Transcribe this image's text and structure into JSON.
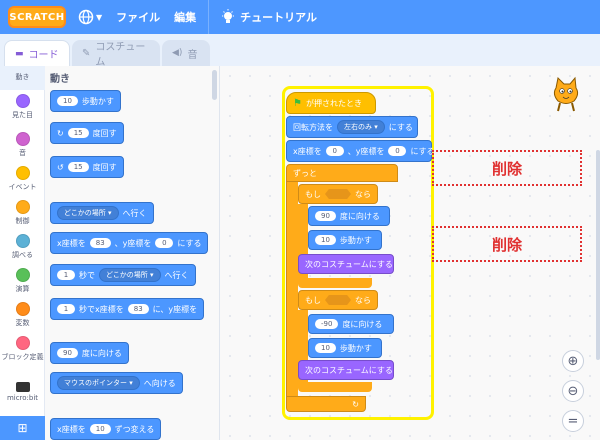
{
  "menu": {
    "logo": "SCRATCH",
    "file": "ファイル",
    "edit": "編集",
    "tutorial": "チュートリアル"
  },
  "tabs": [
    {
      "label": "コード"
    },
    {
      "label": "コスチューム"
    },
    {
      "label": "音"
    }
  ],
  "categories": [
    {
      "label": "動き",
      "color": "#4c97ff"
    },
    {
      "label": "見た目",
      "color": "#9966ff"
    },
    {
      "label": "音",
      "color": "#cf63cf"
    },
    {
      "label": "イベント",
      "color": "#ffbf00"
    },
    {
      "label": "制御",
      "color": "#ffab19"
    },
    {
      "label": "調べる",
      "color": "#5cb1d6"
    },
    {
      "label": "演算",
      "color": "#59c059"
    },
    {
      "label": "変数",
      "color": "#ff8c1a"
    },
    {
      "label": "ブロック定義",
      "color": "#ff6680"
    },
    {
      "label": "micro:bit",
      "color": "#0fbd8c"
    }
  ],
  "palette": {
    "title": "動き",
    "move": {
      "value": "10",
      "text": "歩動かす"
    },
    "turn_right": {
      "value": "15",
      "text": "度回す"
    },
    "turn_left": {
      "value": "15",
      "text": "度回す"
    },
    "goto": {
      "dropdown": "どこかの場所",
      "text": "へ行く"
    },
    "gotoxy": {
      "x_label": "x座標を",
      "x": "83",
      "y_label": "、y座標を",
      "y": "0",
      "text": "にする"
    },
    "glide": {
      "value": "1",
      "mid": "秒で",
      "dropdown": "どこかの場所",
      "text": "へ行く"
    },
    "glidexy": {
      "value": "1",
      "mid": "秒でx座標を",
      "x": "83",
      "sep": "に、y座標を"
    },
    "point": {
      "value": "90",
      "text": "度に向ける"
    },
    "point_towards": {
      "dropdown": "マウスのポインター",
      "text": "へ向ける"
    },
    "change_x": {
      "label": "x座標を",
      "value": "10",
      "text": "ずつ変える"
    }
  },
  "script": {
    "hat": "が押されたとき",
    "rotation": {
      "label": "回転方法を",
      "dropdown": "左右のみ",
      "text": "にする"
    },
    "setxy": {
      "x_label": "x座標を",
      "x": "0",
      "y_label": "、y座標を",
      "y": "0",
      "text": "にする"
    },
    "forever": "ずっと",
    "if1": {
      "if": "もし",
      "then": "なら"
    },
    "point1": {
      "value": "90",
      "text": "度に向ける"
    },
    "move1": {
      "value": "10",
      "text": "歩動かす"
    },
    "costume1": "次のコスチュームにする",
    "if2": {
      "if": "もし",
      "then": "なら"
    },
    "point2": {
      "value": "-90",
      "text": "度に向ける"
    },
    "move2": {
      "value": "10",
      "text": "歩動かす"
    },
    "costume2": "次のコスチュームにする"
  },
  "annotations": {
    "delete1": "削除",
    "delete2": "削除"
  }
}
